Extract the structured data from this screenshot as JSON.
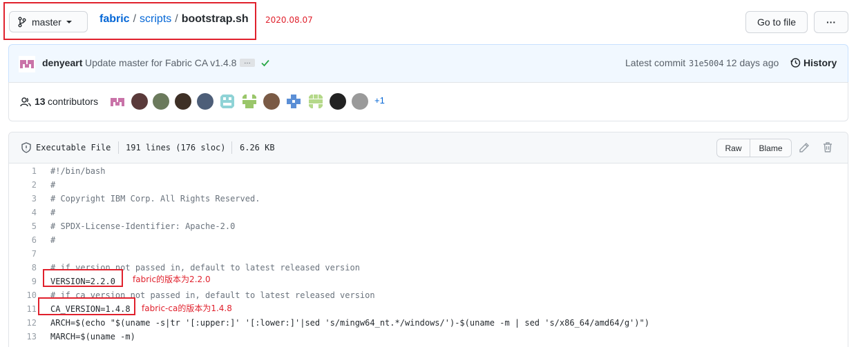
{
  "branch": {
    "name": "master"
  },
  "breadcrumb": {
    "repo": "fabric",
    "sep1": "/",
    "folder": "scripts",
    "sep2": "/",
    "file": "bootstrap.sh"
  },
  "annotation_date": "2020.08.07",
  "toolbar": {
    "go_to_file": "Go to file",
    "more": "···"
  },
  "commit": {
    "author": "denyeart",
    "message": "Update master for Fabric CA v1.4.8",
    "ellipsis": "…",
    "latest_label": "Latest commit",
    "sha": "31e5004",
    "age": "12 days ago",
    "history": "History"
  },
  "contributors": {
    "count": "13",
    "label": "contributors",
    "more": "+1"
  },
  "file_meta": {
    "mode": "Executable File",
    "lines": "191 lines (176 sloc)",
    "size": "6.26 KB",
    "raw": "Raw",
    "blame": "Blame"
  },
  "code_lines": [
    {
      "n": "1",
      "text": "#!/bin/bash",
      "comment": true
    },
    {
      "n": "2",
      "text": "#",
      "comment": true
    },
    {
      "n": "3",
      "text": "# Copyright IBM Corp. All Rights Reserved.",
      "comment": true
    },
    {
      "n": "4",
      "text": "#",
      "comment": true
    },
    {
      "n": "5",
      "text": "# SPDX-License-Identifier: Apache-2.0",
      "comment": true
    },
    {
      "n": "6",
      "text": "#",
      "comment": true
    },
    {
      "n": "7",
      "text": "",
      "comment": false
    },
    {
      "n": "8",
      "text": "# if version not passed in, default to latest released version",
      "comment": true
    },
    {
      "n": "9",
      "text": "VERSION=2.2.0",
      "comment": false
    },
    {
      "n": "10",
      "text": "# if ca version not passed in, default to latest released version",
      "comment": true
    },
    {
      "n": "11",
      "text": "CA_VERSION=1.4.8",
      "comment": false
    },
    {
      "n": "12",
      "text": "ARCH=$(echo \"$(uname -s|tr '[:upper:]' '[:lower:]'|sed 's/mingw64_nt.*/windows/')-$(uname -m | sed 's/x86_64/amd64/g')\")",
      "comment": false
    },
    {
      "n": "13",
      "text": "MARCH=$(uname -m)",
      "comment": false
    }
  ],
  "annotations": {
    "version_note": "fabric的版本为2.2.0",
    "ca_note": "fabric-ca的版本为1.4.8"
  },
  "colors": {
    "link": "#0366d6",
    "annotation_red": "#e0202c",
    "commit_bg": "#f1f8ff",
    "check": "#28a745"
  }
}
